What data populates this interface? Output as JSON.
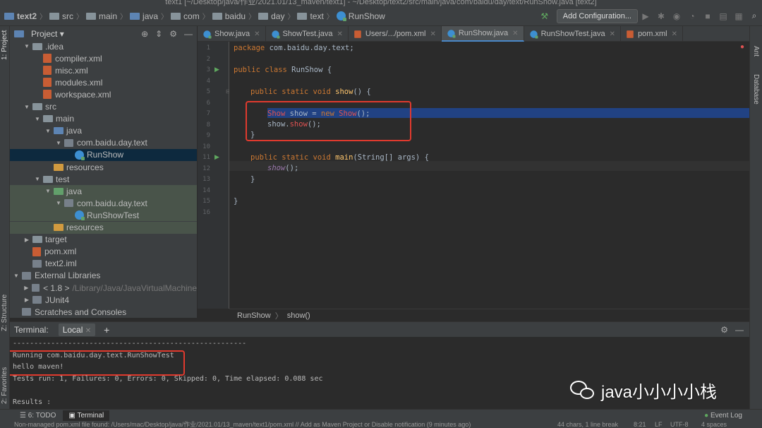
{
  "window": {
    "title": "text1 [~/Desktop/java/作业/2021.01/13_maven/text1] - ~/Desktop/text2/src/main/java/com/baidu/day/text/RunShow.java [text2]"
  },
  "navbar": {
    "crumbs": [
      "text2",
      "src",
      "main",
      "java",
      "com",
      "baidu",
      "day",
      "text",
      "RunShow"
    ],
    "add_config": "Add Configuration..."
  },
  "left_strip": {
    "project": "1: Project",
    "structure": "Z: Structure",
    "favorites": "2: Favorites"
  },
  "right_strip": {
    "ant": "Ant",
    "database": "Database"
  },
  "project_panel": {
    "title": "Project"
  },
  "tree": [
    {
      "label": ".idea",
      "type": "folder",
      "indent": 1,
      "arrow": "down"
    },
    {
      "label": "compiler.xml",
      "type": "xml",
      "indent": 2,
      "arrow": ""
    },
    {
      "label": "misc.xml",
      "type": "xml",
      "indent": 2,
      "arrow": ""
    },
    {
      "label": "modules.xml",
      "type": "xml",
      "indent": 2,
      "arrow": ""
    },
    {
      "label": "workspace.xml",
      "type": "xml",
      "indent": 2,
      "arrow": ""
    },
    {
      "label": "src",
      "type": "folder",
      "indent": 1,
      "arrow": "down"
    },
    {
      "label": "main",
      "type": "folder",
      "indent": 2,
      "arrow": "down"
    },
    {
      "label": "java",
      "type": "folder-blue",
      "indent": 3,
      "arrow": "down"
    },
    {
      "label": "com.baidu.day.text",
      "type": "package",
      "indent": 4,
      "arrow": "down"
    },
    {
      "label": "RunShow",
      "type": "class",
      "indent": 5,
      "arrow": "",
      "selected": true
    },
    {
      "label": "resources",
      "type": "folder-orange",
      "indent": 3,
      "arrow": ""
    },
    {
      "label": "test",
      "type": "folder",
      "indent": 2,
      "arrow": "down"
    },
    {
      "label": "java",
      "type": "folder-green",
      "indent": 3,
      "arrow": "down",
      "test": true
    },
    {
      "label": "com.baidu.day.text",
      "type": "package",
      "indent": 4,
      "arrow": "down",
      "test": true
    },
    {
      "label": "RunShowTest",
      "type": "class",
      "indent": 5,
      "arrow": "",
      "test": true
    },
    {
      "label": "resources",
      "type": "folder-orange",
      "indent": 3,
      "arrow": "",
      "test": true
    },
    {
      "label": "target",
      "type": "folder",
      "indent": 1,
      "arrow": "right"
    },
    {
      "label": "pom.xml",
      "type": "xml",
      "indent": 1,
      "arrow": ""
    },
    {
      "label": "text2.iml",
      "type": "file",
      "indent": 1,
      "arrow": ""
    },
    {
      "label": "External Libraries",
      "type": "lib",
      "indent": 0,
      "arrow": "down"
    },
    {
      "label": "< 1.8 >",
      "suffix": "/Library/Java/JavaVirtualMachine",
      "type": "lib",
      "indent": 1,
      "arrow": "right"
    },
    {
      "label": "JUnit4",
      "type": "lib",
      "indent": 1,
      "arrow": "right"
    },
    {
      "label": "Scratches and Consoles",
      "type": "scratch",
      "indent": 0,
      "arrow": ""
    }
  ],
  "tabs": [
    {
      "label": "Show.java",
      "active": false
    },
    {
      "label": "ShowTest.java",
      "active": false
    },
    {
      "label": "Users/.../pom.xml",
      "active": false
    },
    {
      "label": "RunShow.java",
      "active": true
    },
    {
      "label": "RunShowTest.java",
      "active": false
    },
    {
      "label": "pom.xml",
      "active": false
    }
  ],
  "line_numbers": [
    "1",
    "2",
    "3",
    "4",
    "5",
    "6",
    "7",
    "8",
    "9",
    "10",
    "11",
    "12",
    "13",
    "14",
    "15",
    "16"
  ],
  "code": {
    "l1_kw": "package",
    "l1_rest": " com.baidu.day.text;",
    "l3_kw": "public class",
    "l3_rest": " RunShow {",
    "l5_kw": "public static void",
    "l5_fn": "show",
    "l5_rest": "() {",
    "l7_type": "Show",
    "l7_mid": " show = ",
    "l7_new": "new",
    "l7_call": "Show",
    "l7_end": "();",
    "l8_obj": "show.",
    "l8_call": "show",
    "l8_end": "();",
    "l9": "}",
    "l11_kw": "public static void",
    "l11_fn": "main",
    "l11_rest": "(String[] args) {",
    "l12_call": "show",
    "l12_end": "();",
    "l13": "}",
    "l15": "}"
  },
  "breadcrumb": {
    "cls": "RunShow",
    "method": "show()"
  },
  "terminal": {
    "title": "Terminal:",
    "tab": "Local",
    "add": "+",
    "lines": [
      "-------------------------------------------------------",
      "Running com.baidu.day.text.RunShowTest",
      "hello maven!",
      "Tests run: 1, Failures: 0, Errors: 0, Skipped: 0, Time elapsed: 0.088 sec",
      "",
      "Results :"
    ]
  },
  "bottom_tabs": {
    "todo": "6: TODO",
    "terminal": "Terminal",
    "event_log": "Event Log"
  },
  "status": {
    "message": "Non-managed pom.xml file found: /Users/mac/Desktop/java/作业/2021.01/13_maven/text1/pom.xml // Add as Maven Project or Disable notification (9 minutes ago)",
    "chars": "44 chars, 1 line break",
    "pos": "8:21",
    "lf": "LF",
    "enc": "UTF-8",
    "indent": "4 spaces"
  },
  "watermark": {
    "text": "java小小小小栈"
  }
}
